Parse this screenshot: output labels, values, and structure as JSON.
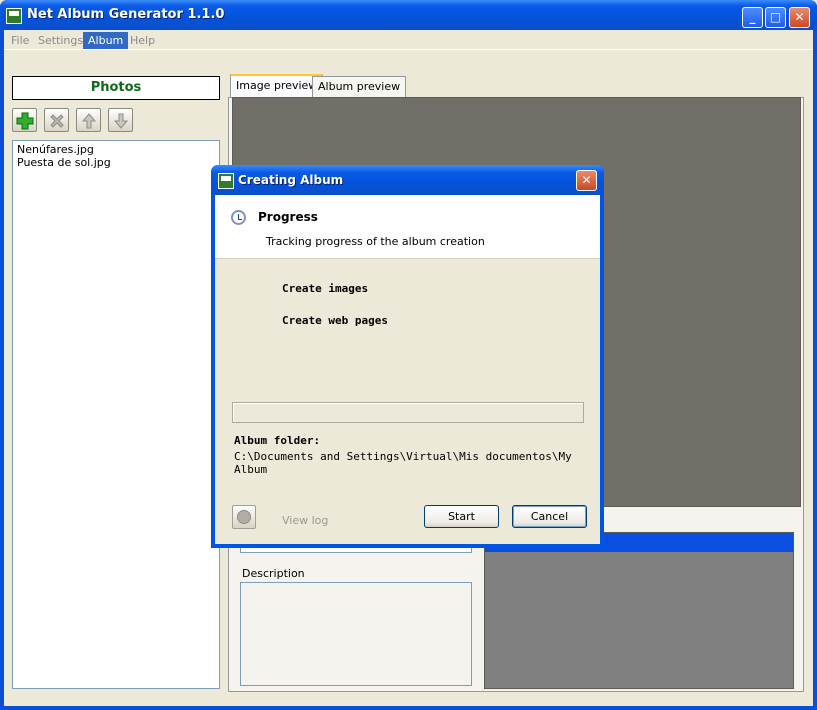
{
  "window": {
    "title": "Net Album Generator 1.1.0",
    "minimize": "_",
    "maximize": "□",
    "close": "✕"
  },
  "menu": [
    {
      "label": "File"
    },
    {
      "label": "Settings"
    },
    {
      "label": "Album",
      "active": true
    },
    {
      "label": "Help"
    }
  ],
  "photos": {
    "header": "Photos",
    "toolbar": {
      "add": "add-icon",
      "remove": "remove-icon",
      "up": "arrow-up-icon",
      "down": "arrow-down-icon"
    },
    "items": [
      "Nenúfares.jpg",
      "Puesta de sol.jpg"
    ]
  },
  "tabs": [
    {
      "label": "Image preview",
      "active": true
    },
    {
      "label": "Album preview"
    }
  ],
  "details": {
    "description_label": "Description"
  },
  "dialog": {
    "title": "Creating Album",
    "close": "✕",
    "header_title": "Progress",
    "header_subtitle": "Tracking progress of the album creation",
    "steps": [
      "Create images",
      "Create web pages"
    ],
    "progress": 0,
    "folder_label": "Album folder:",
    "folder_path": "C:\\Documents and Settings\\Virtual\\Mis documentos\\My Album",
    "view_log": "View log",
    "start": "Start",
    "cancel": "Cancel"
  },
  "colors": {
    "accent": "#0A4FD6",
    "photos_header": "#0B6B17",
    "menu_active": "#316AC5"
  }
}
